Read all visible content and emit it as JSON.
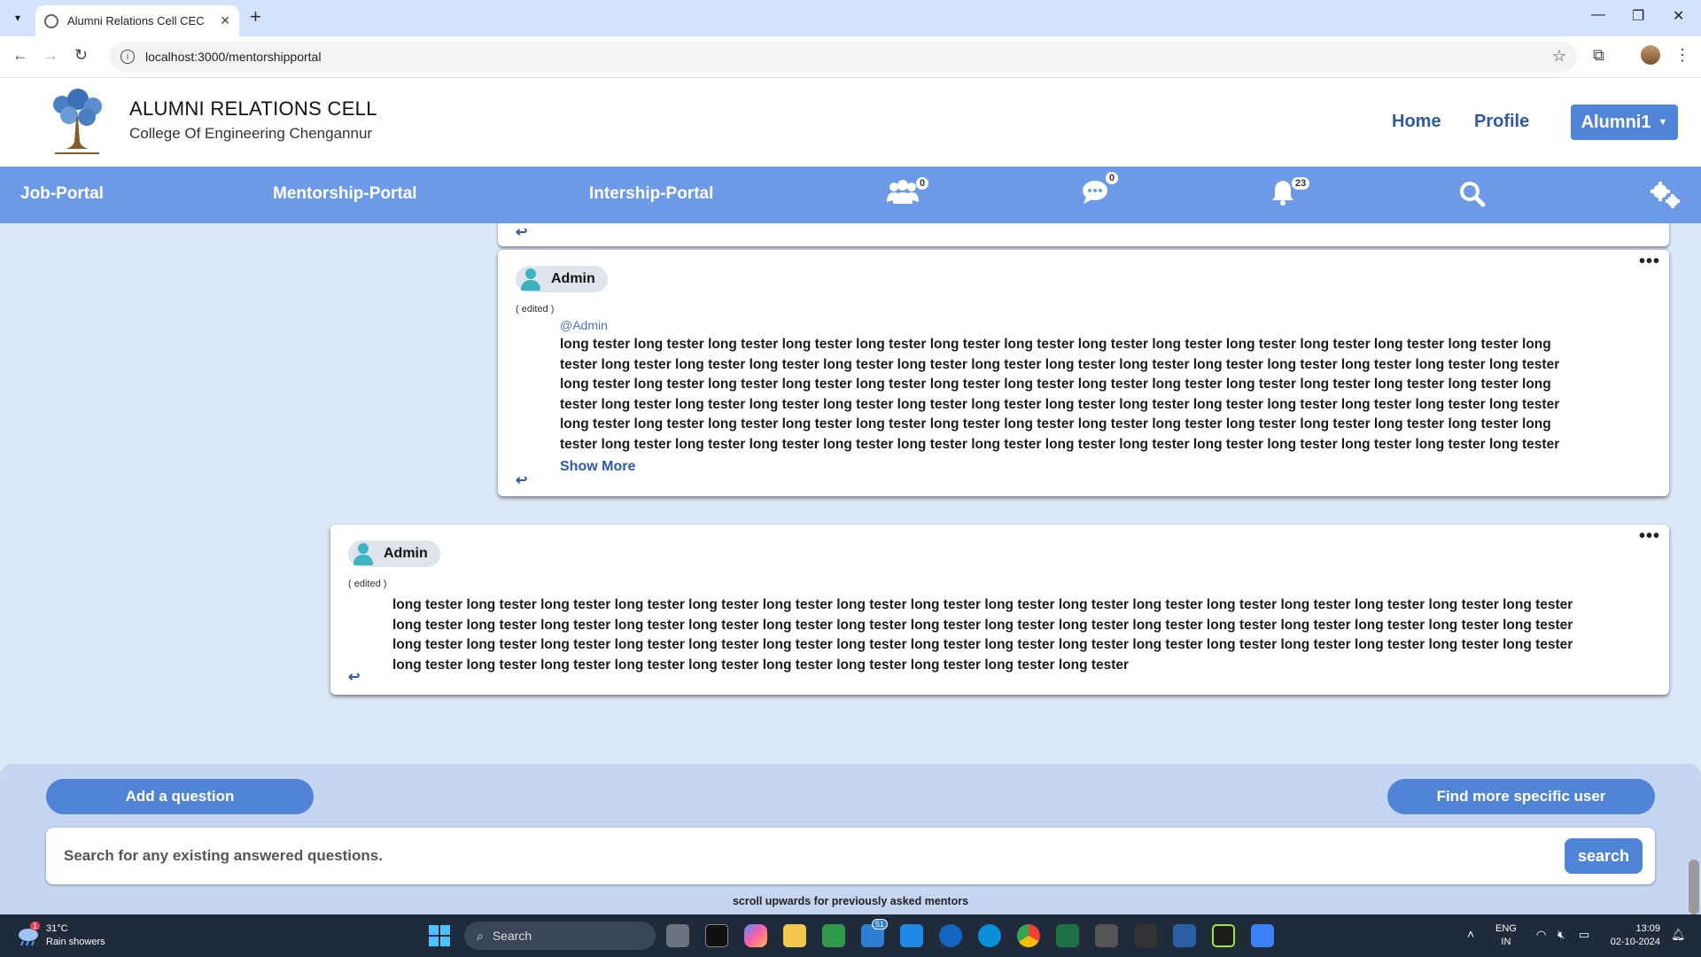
{
  "browser": {
    "tab_title": "Alumni Relations Cell CEC",
    "url": "localhost:3000/mentorshipportal"
  },
  "header": {
    "title": "ALUMNI RELATIONS CELL",
    "subtitle": "College Of Engineering Chengannur",
    "nav_home": "Home",
    "nav_profile": "Profile",
    "user_menu": "Alumni1"
  },
  "navbar": {
    "job_portal": "Job-Portal",
    "mentorship_portal": "Mentorship-Portal",
    "internship_portal": "Intership-Portal",
    "connections_count": "0",
    "messages_count": "0",
    "notifications_count": "23"
  },
  "posts": [
    {
      "user": "Admin",
      "edited": "( edited )",
      "mention": "@Admin",
      "lines": [
        "long tester long tester long tester long tester long tester long tester long tester long tester long tester long tester long tester long tester long tester long",
        "tester long tester long tester long tester long tester long tester long tester long tester long tester long tester long tester long tester long tester long tester",
        "long tester long tester long tester long tester long tester long tester long tester long tester long tester long tester long tester long tester long tester long",
        "tester long tester long tester long tester long tester long tester long tester long tester long tester long tester long tester long tester long tester long tester",
        "long tester long tester long tester long tester long tester long tester long tester long tester long tester long tester long tester long tester long tester long",
        "tester long tester long tester long tester long tester long tester long tester long tester long tester long tester long tester long tester long tester long tester"
      ],
      "show_more": "Show More"
    },
    {
      "user": "Admin",
      "edited": "( edited )",
      "lines": [
        "long tester long tester long tester long tester long tester long tester long tester long tester long tester long tester long tester long tester long tester long tester long tester long tester",
        "long tester long tester long tester long tester long tester long tester long tester long tester long tester long tester long tester long tester long tester long tester long tester long tester",
        "long tester long tester long tester long tester long tester long tester long tester long tester long tester long tester long tester long tester long tester long tester long tester long tester",
        "long tester long tester long tester long tester long tester long tester long tester long tester long tester long tester"
      ]
    }
  ],
  "bottom": {
    "add_question": "Add a question",
    "find_user": "Find more specific user",
    "search_placeholder": "Search for any existing answered questions.",
    "search_button": "search",
    "hint": "scroll upwards for previously asked mentors"
  },
  "taskbar": {
    "weather_temp": "31°C",
    "weather_desc": "Rain showers",
    "weather_badge": "1",
    "search_label": "Search",
    "mail_badge": "51",
    "lang_top": "ENG",
    "lang_bottom": "IN",
    "time": "13:09",
    "date": "02-10-2024"
  },
  "colors": {
    "navbar_bg": "#6c9ae6",
    "brand_blue": "#2e5aa8",
    "button_blue": "#4f84d6",
    "page_bg": "#dce8f8"
  }
}
